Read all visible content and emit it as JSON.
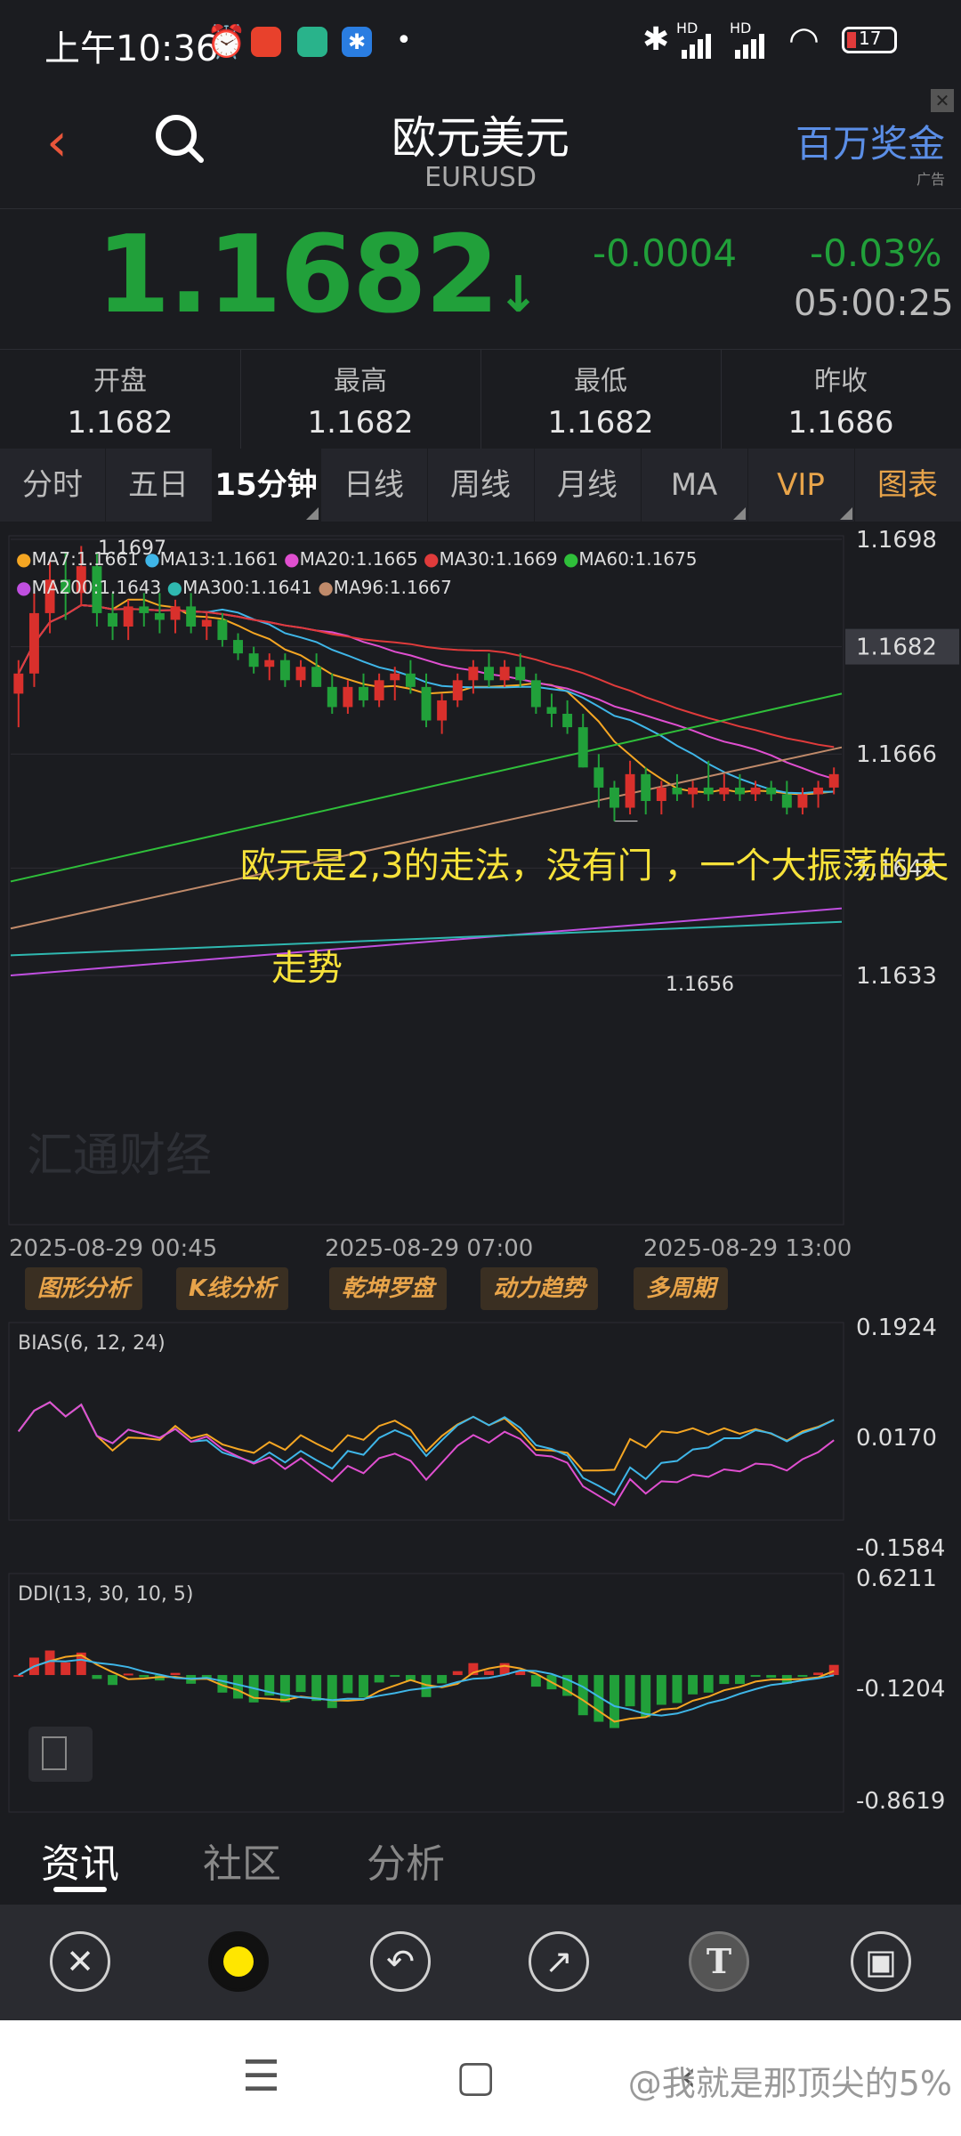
{
  "status": {
    "time": "上午10:36",
    "battery": "17",
    "signal1": "HD",
    "signal2": "HD"
  },
  "header": {
    "title": "欧元美元",
    "symbol": "EURUSD",
    "ad_text": "百万奖金",
    "ad_tag": "广告",
    "ad_close": "✕"
  },
  "quote": {
    "price": "1.1682",
    "arrow": "↓",
    "change": "-0.0004",
    "change_pct": "-0.03%",
    "time": "05:00:25",
    "cells": [
      {
        "label": "开盘",
        "value": "1.1682"
      },
      {
        "label": "最高",
        "value": "1.1682"
      },
      {
        "label": "最低",
        "value": "1.1682"
      },
      {
        "label": "昨收",
        "value": "1.1686"
      }
    ],
    "up_color": "#d9302c",
    "down_color": "#21a03a"
  },
  "tabs": [
    {
      "label": "分时",
      "active": false
    },
    {
      "label": "五日",
      "active": false
    },
    {
      "label": "15分钟",
      "active": true
    },
    {
      "label": "日线",
      "active": false
    },
    {
      "label": "周线",
      "active": false
    },
    {
      "label": "月线",
      "active": false
    },
    {
      "label": "MA",
      "active": false
    },
    {
      "label": "VIP",
      "active": false
    },
    {
      "label": "图表",
      "active": false
    }
  ],
  "main_chart": {
    "ma_legend": [
      {
        "text": "MA7:1.1661",
        "color": "#f5a623"
      },
      {
        "text": "MA13:1.1661",
        "color": "#3fb6e8"
      },
      {
        "text": "MA20:1.1665",
        "color": "#e04fd0"
      },
      {
        "text": "MA30:1.1669",
        "color": "#e03b3b"
      },
      {
        "text": "MA60:1.1675",
        "color": "#2fbf3a"
      },
      {
        "text": "MA200:1.1643",
        "color": "#c04fe0"
      },
      {
        "text": "MA300:1.1641",
        "color": "#2fb8b0"
      },
      {
        "text": "MA96:1.1667",
        "color": "#c08a6a"
      }
    ],
    "y_ticks": [
      "1.1698",
      "1.1682",
      "1.1666",
      "1.1649",
      "1.1633"
    ],
    "current_price_tag": "1.1682",
    "high_label": "1.1697",
    "low_label": "1.1656",
    "x_ticks": [
      "2025-08-29 00:45",
      "2025-08-29 07:00",
      "2025-08-29 13:00"
    ],
    "watermark": "汇通财经",
    "annotation_line1": "欧元是2,3的走法，没有门 ，一个大振荡的夫",
    "annotation_line2": "走势",
    "ylim": [
      1.1633,
      1.1698
    ]
  },
  "analysis_buttons": [
    "图形分析",
    "K线分析",
    "乾坤罗盘",
    "动力趋势",
    "多周期"
  ],
  "bias": {
    "label": "BIAS(6, 12, 24)",
    "y_ticks": [
      "0.1924",
      "0.0170",
      "-0.1584"
    ]
  },
  "ddi": {
    "label": "DDI(13, 30, 10, 5)",
    "y_ticks": [
      "0.6211",
      "-0.1204",
      "-0.8619"
    ]
  },
  "news_tabs": [
    {
      "label": "资讯",
      "active": true
    },
    {
      "label": "社区",
      "active": false
    },
    {
      "label": "分析",
      "active": false
    }
  ],
  "toolbar": {
    "close_icon": "✕",
    "undo_icon": "↶",
    "arrow_icon": "↗",
    "text_icon": "T",
    "save_icon": "▣",
    "color": "#ffe600"
  },
  "nav": {
    "menu_icon": "☰",
    "home_icon": "▢",
    "back_icon": "‹"
  },
  "watermark": "@我就是那顶尖的5%",
  "chart_data": [
    {
      "type": "candlestick",
      "title": "EURUSD 15分钟",
      "ylim": [
        1.1633,
        1.1698
      ],
      "x_ticks": [
        "2025-08-29 00:45",
        "2025-08-29 07:00",
        "2025-08-29 13:00"
      ],
      "candles": [
        [
          1.1675,
          1.168,
          1.167,
          1.1678
        ],
        [
          1.1678,
          1.169,
          1.1676,
          1.1687
        ],
        [
          1.1687,
          1.1695,
          1.1684,
          1.1692
        ],
        [
          1.1692,
          1.1696,
          1.1686,
          1.169
        ],
        [
          1.169,
          1.1697,
          1.1688,
          1.1694
        ],
        [
          1.1694,
          1.1696,
          1.1685,
          1.1687
        ],
        [
          1.1687,
          1.169,
          1.1683,
          1.1685
        ],
        [
          1.1685,
          1.1689,
          1.1683,
          1.1688
        ],
        [
          1.1688,
          1.169,
          1.1685,
          1.1687
        ],
        [
          1.1687,
          1.169,
          1.1684,
          1.1686
        ],
        [
          1.1686,
          1.1689,
          1.1684,
          1.1688
        ],
        [
          1.1688,
          1.169,
          1.1684,
          1.1685
        ],
        [
          1.1685,
          1.1687,
          1.1683,
          1.1686
        ],
        [
          1.1686,
          1.1687,
          1.1682,
          1.1683
        ],
        [
          1.1683,
          1.1684,
          1.168,
          1.1681
        ],
        [
          1.1681,
          1.1682,
          1.1678,
          1.1679
        ],
        [
          1.1679,
          1.1681,
          1.1677,
          1.168
        ],
        [
          1.168,
          1.1681,
          1.1676,
          1.1677
        ],
        [
          1.1677,
          1.168,
          1.1676,
          1.1679
        ],
        [
          1.1679,
          1.1681,
          1.1676,
          1.1676
        ],
        [
          1.1676,
          1.1678,
          1.1672,
          1.1673
        ],
        [
          1.1673,
          1.1677,
          1.1672,
          1.1676
        ],
        [
          1.1676,
          1.1678,
          1.1673,
          1.1674
        ],
        [
          1.1674,
          1.1678,
          1.1673,
          1.1677
        ],
        [
          1.1677,
          1.1679,
          1.1674,
          1.1678
        ],
        [
          1.1678,
          1.168,
          1.1675,
          1.1676
        ],
        [
          1.1676,
          1.1678,
          1.167,
          1.1671
        ],
        [
          1.1671,
          1.1675,
          1.1669,
          1.1674
        ],
        [
          1.1674,
          1.1678,
          1.1673,
          1.1677
        ],
        [
          1.1677,
          1.168,
          1.1675,
          1.1679
        ],
        [
          1.1679,
          1.1681,
          1.1676,
          1.1677
        ],
        [
          1.1677,
          1.168,
          1.1676,
          1.1679
        ],
        [
          1.1679,
          1.1681,
          1.1676,
          1.1677
        ],
        [
          1.1677,
          1.1678,
          1.1672,
          1.1673
        ],
        [
          1.1673,
          1.1675,
          1.167,
          1.1672
        ],
        [
          1.1672,
          1.1674,
          1.1669,
          1.167
        ],
        [
          1.167,
          1.1672,
          1.1664,
          1.1664
        ],
        [
          1.1664,
          1.1666,
          1.1658,
          1.1661
        ],
        [
          1.1661,
          1.1662,
          1.1656,
          1.1658
        ],
        [
          1.1658,
          1.1665,
          1.1657,
          1.1663
        ],
        [
          1.1663,
          1.1664,
          1.1657,
          1.1659
        ],
        [
          1.1659,
          1.1662,
          1.1657,
          1.1661
        ],
        [
          1.1661,
          1.1663,
          1.1659,
          1.166
        ],
        [
          1.166,
          1.1662,
          1.1658,
          1.1661
        ],
        [
          1.1661,
          1.1665,
          1.1659,
          1.166
        ],
        [
          1.166,
          1.1663,
          1.1659,
          1.1661
        ],
        [
          1.1661,
          1.1663,
          1.1659,
          1.166
        ],
        [
          1.166,
          1.1662,
          1.1659,
          1.1661
        ],
        [
          1.1661,
          1.1662,
          1.1659,
          1.166
        ],
        [
          1.166,
          1.1662,
          1.1657,
          1.1658
        ],
        [
          1.1658,
          1.1661,
          1.1657,
          1.166
        ],
        [
          1.166,
          1.1662,
          1.1658,
          1.1661
        ],
        [
          1.1661,
          1.1664,
          1.166,
          1.1663
        ]
      ]
    },
    {
      "type": "bar",
      "title": "DDI(13, 30, 10, 5)",
      "ylim": [
        -0.8619,
        0.6211
      ]
    }
  ]
}
